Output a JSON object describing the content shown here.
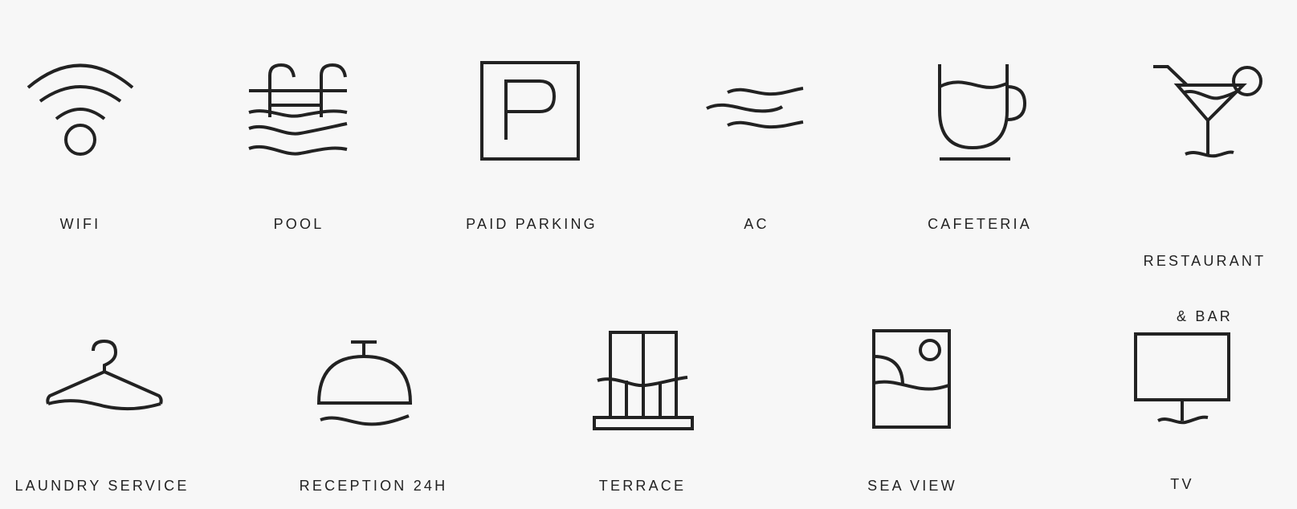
{
  "amenities": {
    "wifi": {
      "label": "WIFI",
      "icon": "wifi-icon"
    },
    "pool": {
      "label": "POOL",
      "icon": "pool-icon"
    },
    "paid_parking": {
      "label": "PAID PARKING",
      "icon": "parking-icon"
    },
    "ac": {
      "label": "AC",
      "icon": "air-conditioning-icon"
    },
    "cafeteria": {
      "label": "CAFETERIA",
      "icon": "coffee-cup-icon"
    },
    "restaurant_bar": {
      "label_line1": "RESTAURANT",
      "label_line2": "& BAR",
      "icon": "cocktail-icon"
    },
    "laundry": {
      "label": "LAUNDRY SERVICE",
      "icon": "hanger-icon"
    },
    "reception": {
      "label": "RECEPTION 24H",
      "icon": "reception-bell-icon"
    },
    "terrace": {
      "label": "TERRACE",
      "icon": "balcony-icon"
    },
    "sea_view": {
      "label": "SEA VIEW",
      "icon": "sea-view-icon"
    },
    "tv": {
      "label": "TV",
      "icon": "tv-icon"
    }
  },
  "colors": {
    "background": "#f7f7f7",
    "ink": "#222222"
  }
}
